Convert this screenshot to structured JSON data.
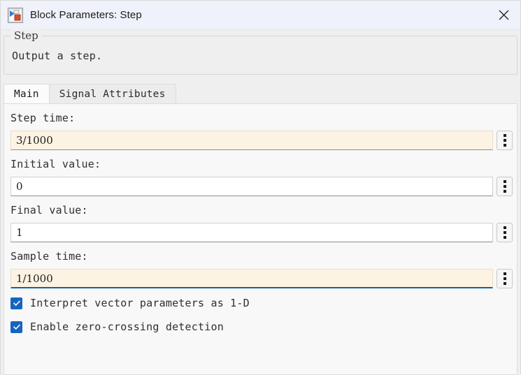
{
  "window": {
    "title": "Block Parameters: Step",
    "icon": "simulink-block-icon",
    "close_label": "✕"
  },
  "description": {
    "legend": "Step",
    "text": "Output a step."
  },
  "tabs": [
    {
      "label": "Main",
      "active": true
    },
    {
      "label": "Signal Attributes",
      "active": false
    }
  ],
  "fields": [
    {
      "label": "Step time:",
      "value": "3/1000",
      "state": "highlight",
      "menu_icon": "kebab-menu-icon"
    },
    {
      "label": "Initial value:",
      "value": "0",
      "state": "normal",
      "menu_icon": "kebab-menu-icon"
    },
    {
      "label": "Final value:",
      "value": "1",
      "state": "normal",
      "menu_icon": "kebab-menu-icon"
    },
    {
      "label": "Sample time:",
      "value": "1/1000",
      "state": "focused",
      "menu_icon": "kebab-menu-icon"
    }
  ],
  "checkboxes": [
    {
      "label": "Interpret vector parameters as 1-D",
      "checked": true
    },
    {
      "label": "Enable zero-crossing detection",
      "checked": true
    }
  ],
  "colors": {
    "titlebar_bg": "#EFF2FA",
    "dialog_bg": "#EFEFEF",
    "panel_bg": "#F8F8F8",
    "field_highlight": "#FDF3E3",
    "focus_underline": "#0A63AE",
    "checkbox_blue": "#1565C0"
  }
}
